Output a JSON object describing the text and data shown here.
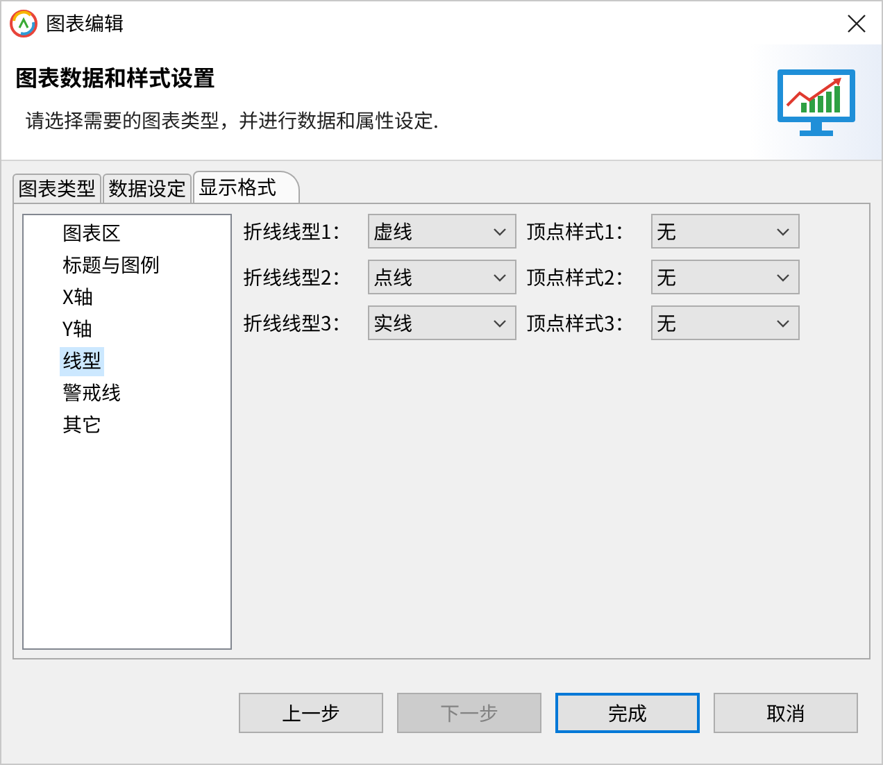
{
  "window": {
    "title": "图表编辑"
  },
  "header": {
    "title": "图表数据和样式设置",
    "description": "请选择需要的图表类型，并进行数据和属性设定."
  },
  "tabs": [
    {
      "label": "图表类型",
      "selected": false
    },
    {
      "label": "数据设定",
      "selected": false
    },
    {
      "label": "显示格式",
      "selected": true
    }
  ],
  "sidebar": {
    "items": [
      {
        "label": "图表区",
        "selected": false
      },
      {
        "label": "标题与图例",
        "selected": false
      },
      {
        "label": "X轴",
        "selected": false
      },
      {
        "label": "Y轴",
        "selected": false
      },
      {
        "label": "线型",
        "selected": true
      },
      {
        "label": "警戒线",
        "selected": false
      },
      {
        "label": "其它",
        "selected": false
      }
    ]
  },
  "rows": [
    {
      "line_label": "折线线型1：",
      "line_value": "虚线",
      "vertex_label": "顶点样式1：",
      "vertex_value": "无"
    },
    {
      "line_label": "折线线型2：",
      "line_value": "点线",
      "vertex_label": "顶点样式2：",
      "vertex_value": "无"
    },
    {
      "line_label": "折线线型3：",
      "line_value": "实线",
      "vertex_label": "顶点样式3：",
      "vertex_value": "无"
    }
  ],
  "buttons": [
    {
      "label": "上一步",
      "disabled": false,
      "default": false
    },
    {
      "label": "下一步",
      "disabled": true,
      "default": false
    },
    {
      "label": "完成",
      "disabled": false,
      "default": true
    },
    {
      "label": "取消",
      "disabled": false,
      "default": false
    }
  ]
}
